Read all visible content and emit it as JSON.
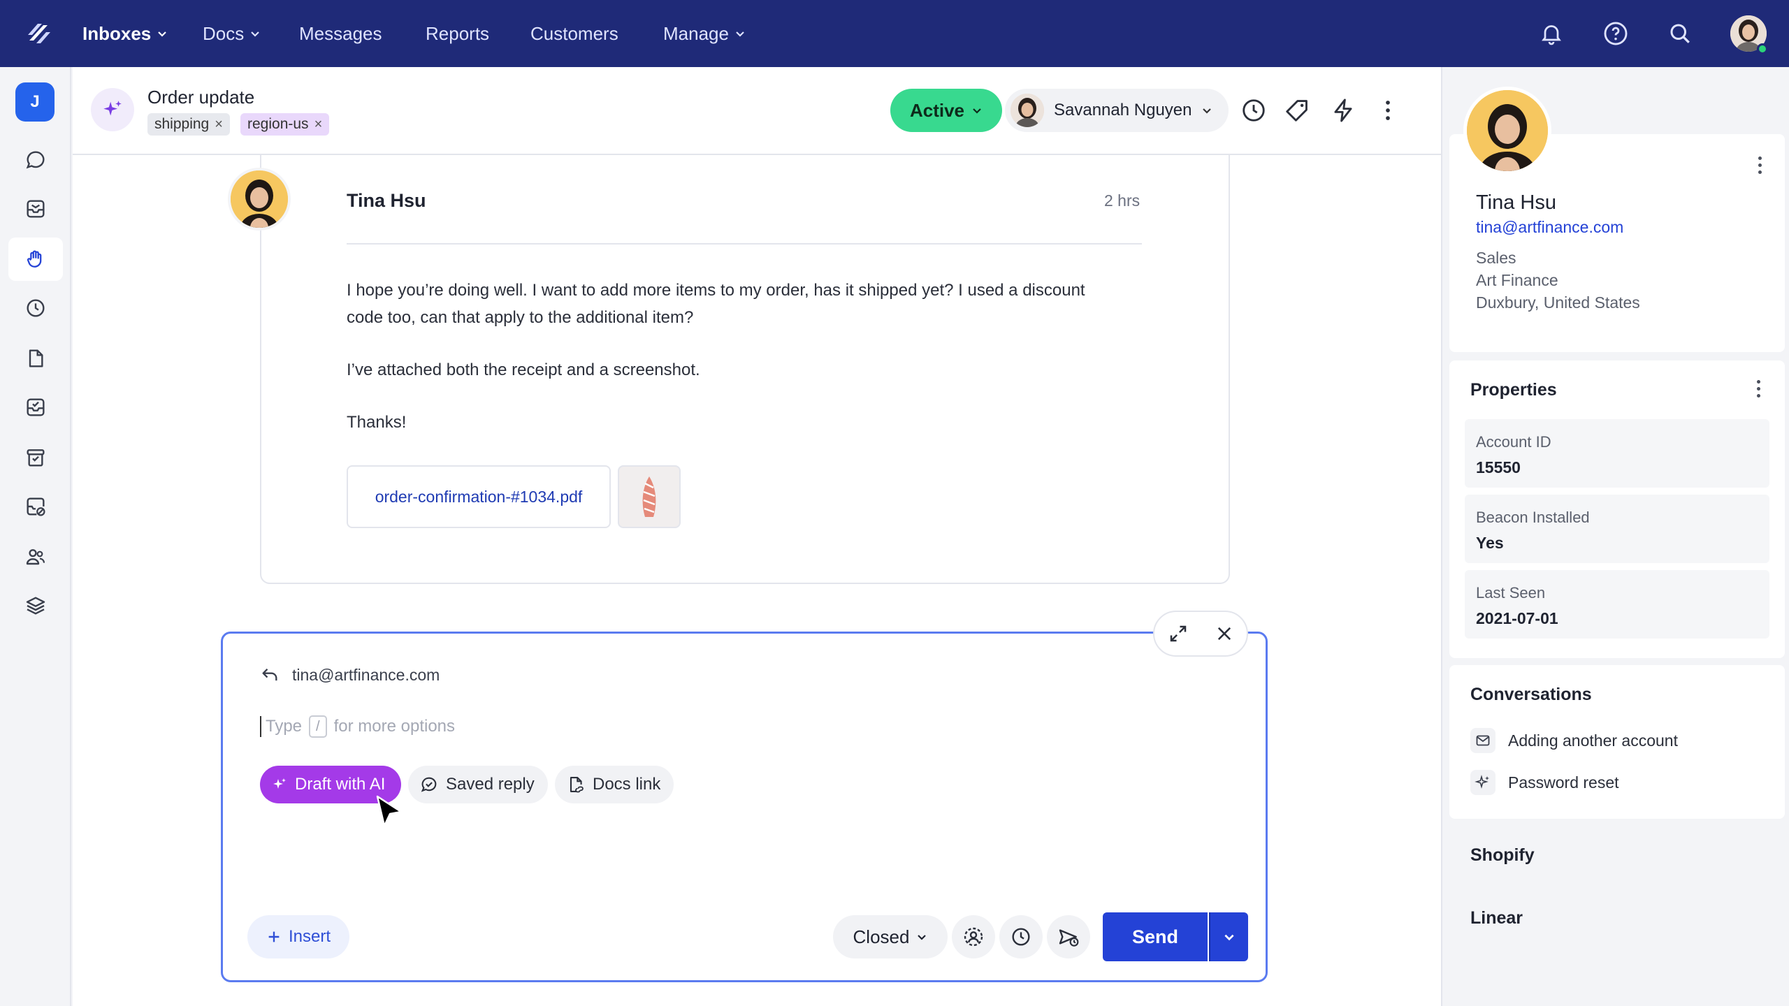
{
  "nav": {
    "items": [
      {
        "label": "Inboxes",
        "dropdown": true,
        "active": true
      },
      {
        "label": "Docs",
        "dropdown": true
      },
      {
        "label": "Messages"
      },
      {
        "label": "Reports"
      },
      {
        "label": "Customers"
      },
      {
        "label": "Manage",
        "dropdown": true
      }
    ],
    "icons": [
      "bell-icon",
      "help-icon",
      "search-icon",
      "user-avatar"
    ],
    "colors": {
      "nav_bg": "#1f2a78",
      "online": "#2bd37a"
    }
  },
  "rail": {
    "avatar_initial": "J",
    "icons": [
      "chat-icon",
      "inbox-icon",
      "hand-icon",
      "clock-icon",
      "document-icon",
      "inbox-check-icon",
      "archive-icon",
      "inbox-block-icon",
      "users-icon",
      "layers-icon"
    ],
    "selected_index": 2
  },
  "conversation": {
    "title": "Order update",
    "tags": [
      {
        "label": "shipping",
        "remove": "×"
      },
      {
        "label": "region-us",
        "remove": "×"
      }
    ],
    "status": "Active",
    "assignee": "Savannah Nguyen",
    "header_icons": [
      "history-icon",
      "tag-icon",
      "bolt-icon",
      "more-icon"
    ]
  },
  "message": {
    "from": "Tina Hsu",
    "time": "2 hrs",
    "paragraphs": [
      "I hope you’re doing well. I want to add more items to my order, has it shipped yet? I used a discount",
      "code too, can that apply to the additional item?",
      "I’ve attached both the receipt and a screenshot.",
      "Thanks!"
    ],
    "attachments": [
      {
        "name": "order-confirmation-#1034.pdf"
      }
    ]
  },
  "composer": {
    "reply_to": "tina@artfinance.com",
    "placeholder_before": "Type",
    "placeholder_key": "/",
    "placeholder_after": "for more options",
    "chips": {
      "ai": "Draft with AI",
      "saved": "Saved reply",
      "docs": "Docs link"
    },
    "insert_label": "Insert",
    "status_after_send": "Closed",
    "send_label": "Send"
  },
  "profile": {
    "name": "Tina Hsu",
    "email": "tina@artfinance.com",
    "role": "Sales",
    "company": "Art Finance",
    "location": "Duxbury, United States"
  },
  "properties": {
    "title": "Properties",
    "items": [
      {
        "label": "Account ID",
        "value": "15550"
      },
      {
        "label": "Beacon Installed",
        "value": "Yes"
      },
      {
        "label": "Last Seen",
        "value": "2021-07-01"
      }
    ]
  },
  "conversations": {
    "title": "Conversations",
    "items": [
      {
        "label": "Adding another account",
        "icon": "mail-icon"
      },
      {
        "label": "Password reset",
        "icon": "sparkle-icon"
      }
    ]
  },
  "integrations": [
    "Shopify",
    "Linear"
  ]
}
